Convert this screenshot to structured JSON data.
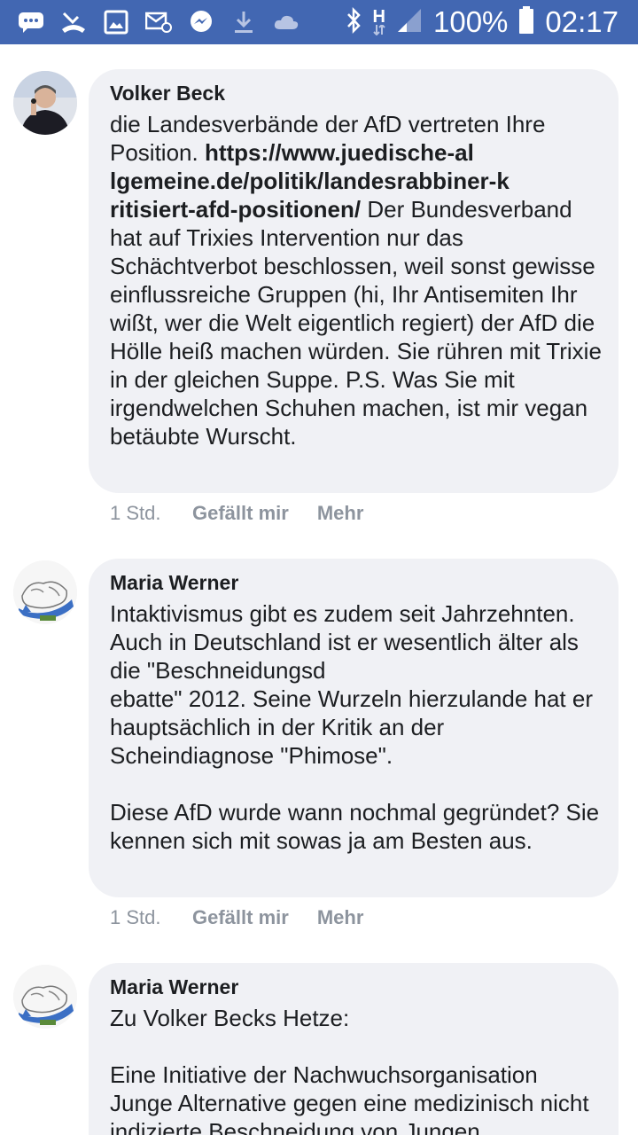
{
  "status_bar": {
    "battery": "100%",
    "time": "02:17",
    "network": "H"
  },
  "comments": [
    {
      "author": "Volker Beck",
      "text_before_link": "die Landesverbände der AfD vertreten Ihre Position. ",
      "link": "https://www.juedische-al\nlgemeine.de/politik/landesrabbiner-k\nritisiert-afd-positionen/",
      "text_after_link": " Der Bundesverband hat auf Trixies Intervention nur das Schächtverbot beschlossen, weil sonst gewisse einflussreiche Gruppen (hi, Ihr Antisemiten Ihr wißt, wer die Welt eigentlich regiert) der AfD die Hölle heiß machen würden. Sie rühren mit Trixie in der gleichen Suppe. P.S. Was Sie mit irgendwelchen Schuhen machen, ist mir vegan betäubte Wurscht.",
      "time": "1 Std.",
      "like_label": "Gefällt mir",
      "more_label": "Mehr"
    },
    {
      "author": "Maria Werner",
      "text": "Intaktivismus gibt es zudem seit Jahrzehnten. Auch in Deutschland ist er wesentlich älter als die \"Beschneidungsd\nebatte\" 2012. Seine Wurzeln hierzulande hat er hauptsächlich in der Kritik an der Scheindiagnose \"Phimose\".\n\nDiese AfD wurde wann nochmal gegründet? Sie kennen sich mit sowas ja am Besten aus.",
      "time": "1 Std.",
      "like_label": "Gefällt mir",
      "more_label": "Mehr"
    },
    {
      "author": "Maria Werner",
      "text": "Zu Volker Becks Hetze:\n\nEine Initiative der Nachwuchsorganisation Junge Alternative gegen eine medizinisch nicht indizierte Beschneidung von Jungen"
    }
  ]
}
